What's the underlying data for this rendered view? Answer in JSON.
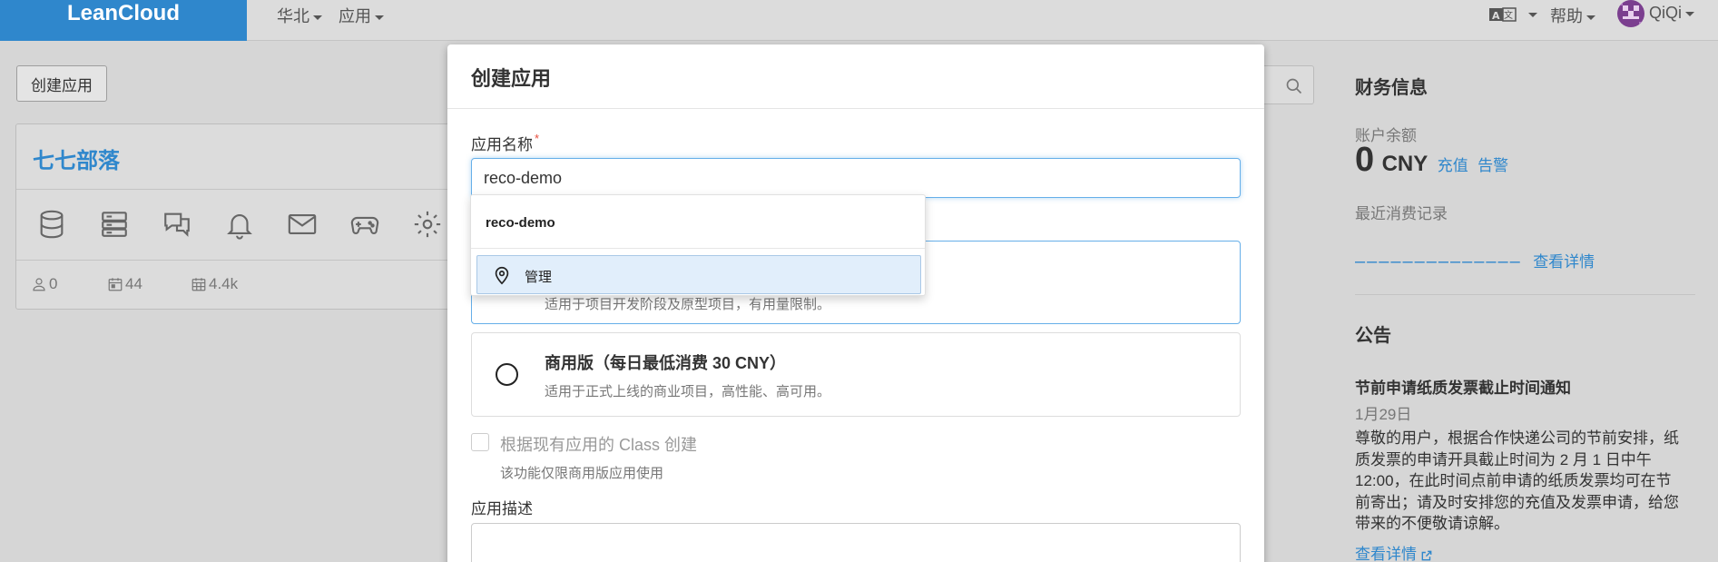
{
  "navbar": {
    "brand": "LeanCloud",
    "region": "华北",
    "apps": "应用",
    "help": "帮助",
    "user": "QiQi"
  },
  "toolbar": {
    "create_label": "创建应用"
  },
  "app_card": {
    "title": "七七部落",
    "services": [
      "database-icon",
      "server-icon",
      "chat-icon",
      "bell-icon",
      "mail-icon",
      "gamepad-icon",
      "gear-icon"
    ],
    "stats": {
      "users": "0",
      "days": "44",
      "requests": "4.4k"
    }
  },
  "sidebar": {
    "finance_title": "财务信息",
    "balance_label": "账户余额",
    "balance_value": "0",
    "balance_unit": "CNY",
    "recharge": "充值",
    "alert": "告警",
    "recent_label": "最近消费记录",
    "dashes": "––––––––––––––",
    "details": "查看详情",
    "notice_title": "公告",
    "notice_heading": "节前申请纸质发票截止时间通知",
    "notice_date": "1月29日",
    "notice_line1": "尊敬的用户，根据合作快递公司的节前安排，纸",
    "notice_line2": "质发票的申请开具截止时间为 2 月 1 日中午",
    "notice_line3": "12:00，在此时间点前申请的纸质发票均可在节",
    "notice_line4": "前寄出；请及时安排您的充值及发票申请，给您",
    "notice_line5": "带来的不便敬请谅解。",
    "notice_link": "查看详情"
  },
  "modal": {
    "title": "创建应用",
    "name_label": "应用名称",
    "name_value": "reco-demo",
    "dev_plan_desc": "适用于项目开发阶段及原型项目，有用量限制。",
    "biz_plan_title": "商用版（每日最低消费 30 CNY）",
    "biz_plan_desc": "适用于正式上线的商业项目，高性能、高可用。",
    "clone_label": "根据现有应用的 Class 创建",
    "clone_hint": "该功能仅限商用版应用使用",
    "desc_label": "应用描述"
  },
  "autocomplete": {
    "suggestion": "reco-demo",
    "manage": "管理"
  },
  "colors": {
    "accent": "#2f87cc",
    "overlay": "#d6d6d6"
  }
}
